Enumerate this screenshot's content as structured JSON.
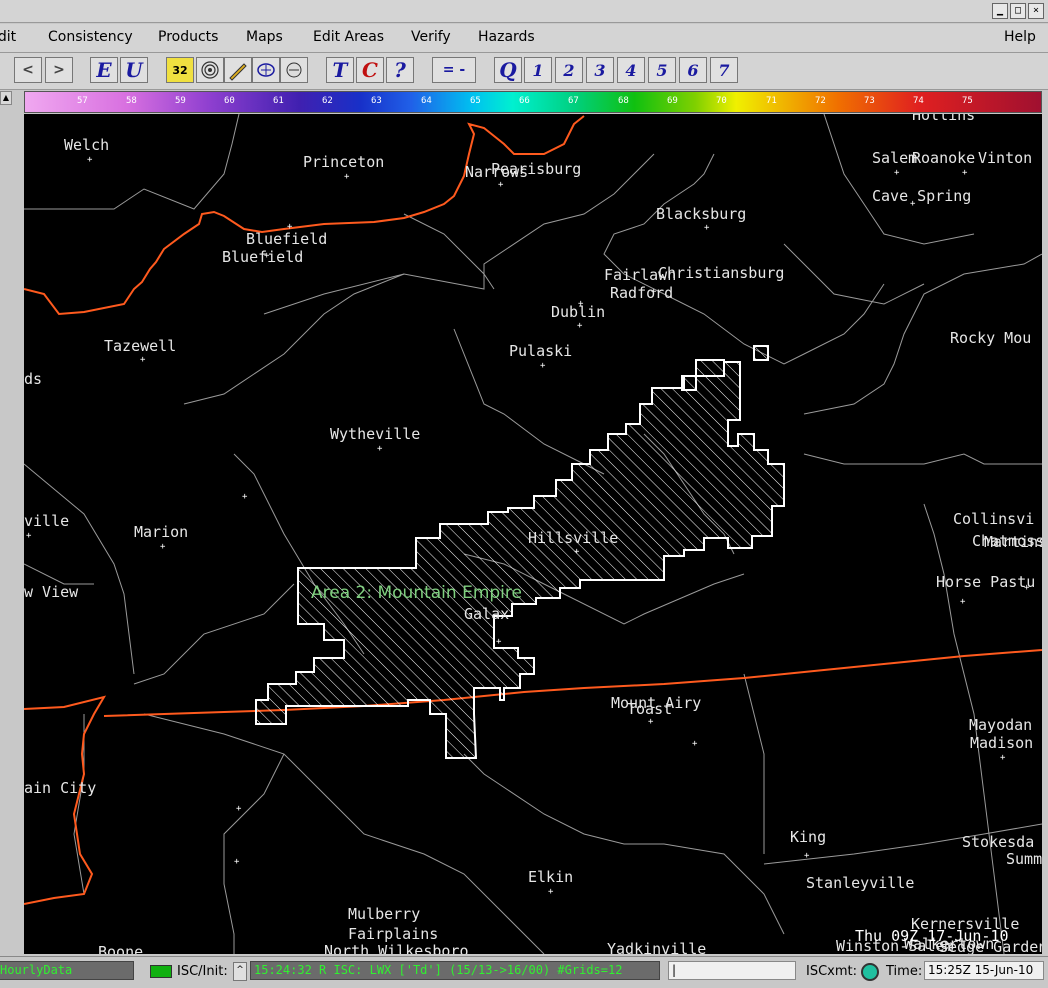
{
  "menu": {
    "items": [
      "Edit",
      "Consistency",
      "Products",
      "Maps",
      "Edit Areas",
      "Verify",
      "Hazards"
    ],
    "help": "Help"
  },
  "toolbar": {
    "nav_left": "<",
    "nav_right": ">",
    "e_label": "E",
    "u_label": "U",
    "num32_label": "32",
    "t_label": "T",
    "c_label": "C",
    "q_mark_label": "?",
    "eq_label": "= -",
    "q_label": "Q",
    "numbers": [
      "1",
      "2",
      "3",
      "4",
      "5",
      "6",
      "7"
    ]
  },
  "color_bar": {
    "values": [
      "57",
      "58",
      "59",
      "60",
      "61",
      "62",
      "63",
      "64",
      "65",
      "66",
      "67",
      "68",
      "69",
      "70",
      "71",
      "72",
      "73",
      "74",
      "75"
    ]
  },
  "map": {
    "edit_area_label": "Area 2: Mountain Empire",
    "timestamp": "Thu 09Z 17-Jun-10",
    "cities": [
      "Welch",
      "Princeton",
      "Narrows",
      "Pearisburg",
      "Blacksburg",
      "Salem",
      "Roanoke",
      "Vinton",
      "Cave Spring",
      "Bluefield",
      "Bluefield",
      "Fairlawn",
      "Christiansburg",
      "Radford",
      "Dublin",
      "Tazewell",
      "Pulaski",
      "Rocky Mou",
      "ds",
      "Wytheville",
      "ville",
      "Marion",
      "Hillsville",
      "Collinsvi",
      "Chatmoss",
      "Martinsville",
      "w View",
      "Horse Pastu",
      "Galax",
      "Mount Airy",
      "Toast",
      "Mayodan",
      "Madison",
      "ain City",
      "King",
      "Stokesda",
      "Summ",
      "Elkin",
      "Stanleyville",
      "Mulberry",
      "Fairplains",
      "North Wilkesboro",
      "Kernersville",
      "Winston-Salem",
      "Walkertown",
      "Boone",
      "Yadkinville",
      "Sedge Garden",
      "Hollins"
    ]
  },
  "status": {
    "left_text": "HourlyData",
    "isc_init_label": "ISC/Init:",
    "message": "15:24:32 R ISC: LWX ['Td'] (15/13->16/00) #Grids=12",
    "cursor": "|",
    "iscxmt_label": "ISCxmt:",
    "time_label": "Time:",
    "time_value": "15:25Z 15-Jun-10"
  },
  "colors": {
    "map_background": "#000000",
    "state_border": "#ff5a1e",
    "county_line": "#9a9a9a",
    "edit_area_outline": "#ffffff",
    "edit_area_label": "#7fd07f",
    "status_text": "#30f030"
  }
}
